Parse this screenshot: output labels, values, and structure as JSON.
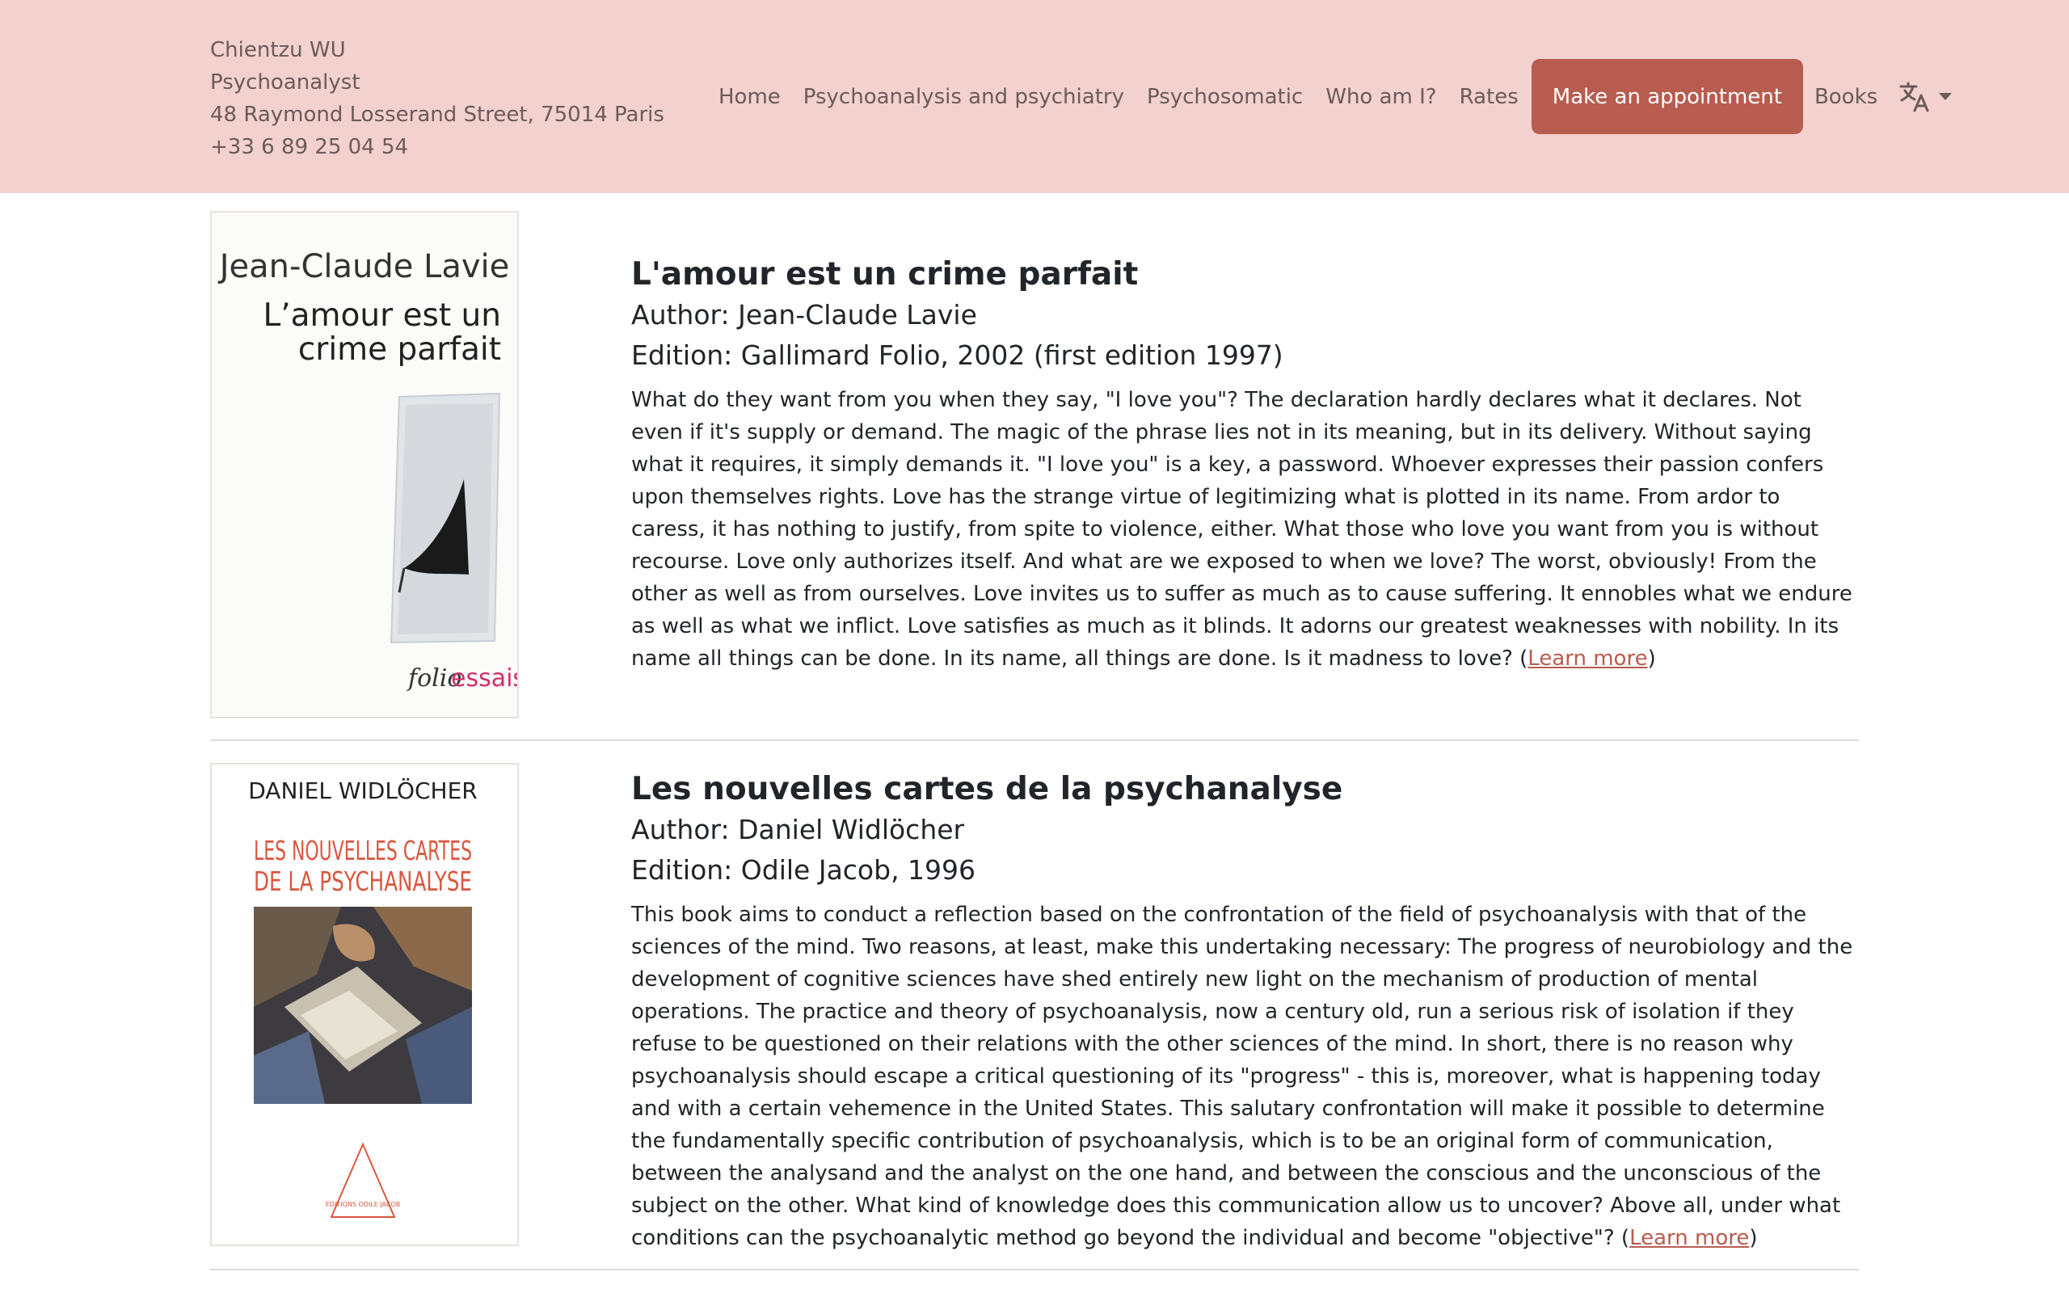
{
  "contact": {
    "name": "Chientzu WU",
    "role": "Psychoanalyst",
    "address": "48 Raymond Losserand Street, 75014 Paris",
    "phone": "+33 6 89 25 04 54"
  },
  "nav": {
    "home": "Home",
    "psychoanalysis": "Psychoanalysis and psychiatry",
    "psychosomatic": "Psychosomatic",
    "who": "Who am I?",
    "rates": "Rates",
    "appointment": "Make an appointment",
    "books": "Books",
    "language_icon": "translate-icon"
  },
  "colors": {
    "header_bg": "#f3d1ce",
    "accent": "#b85c4f",
    "nav_text": "#6b5b5a"
  },
  "books": [
    {
      "title": "L'amour est un crime parfait",
      "author": "Author: Jean-Claude Lavie",
      "edition": "Edition: Gallimard Folio, 2002 (first edition 1997)",
      "description": "What do they want from you when they say, \"I love you\"? The declaration hardly declares what it declares. Not even if it's supply or demand. The magic of the phrase lies not in its meaning, but in its delivery. Without saying what it requires, it simply demands it. \"I love you\" is a key, a password. Whoever expresses their passion confers upon themselves rights. Love has the strange virtue of legitimizing what is plotted in its name. From ardor to caress, it has nothing to justify, from spite to violence, either. What those who love you want from you is without recourse. Love only authorizes itself. And what are we exposed to when we love? The worst, obviously! From the other as well as from ourselves. Love invites us to suffer as much as to cause suffering. It ennobles what we endure as well as what we inflict. Love satisfies as much as it blinds. It adorns our greatest weaknesses with nobility. In its name all things can be done. In its name, all things are done. Is it madness to love? (",
      "learn_more": "Learn more",
      "close_paren": ")",
      "cover": {
        "author": "Jean-Claude Lavie",
        "title_line1": "L’amour est un",
        "title_line2": "crime parfait",
        "publisher_a": "folio",
        "publisher_b": "essais"
      }
    },
    {
      "title": "Les nouvelles cartes de la psychanalyse",
      "author": "Author: Daniel Widlöcher",
      "edition": "Edition: Odile Jacob, 1996",
      "description": "This book aims to conduct a reflection based on the confrontation of the field of psychoanalysis with that of the sciences of the mind. Two reasons, at least, make this undertaking necessary: The progress of neurobiology and the development of cognitive sciences have shed entirely new light on the mechanism of production of mental operations. The practice and theory of psychoanalysis, now a century old, run a serious risk of isolation if they refuse to be questioned on their relations with the other sciences of the mind. In short, there is no reason why psychoanalysis should escape a critical questioning of its \"progress\" - this is, moreover, what is happening today and with a certain vehemence in the United States. This salutary confrontation will make it possible to determine the fundamentally specific contribution of psychoanalysis, which is to be an original form of communication, between the analysand and the analyst on the one hand, and between the conscious and the unconscious of the subject on the other. What kind of knowledge does this communication allow us to uncover? Above all, under what conditions can the psychoanalytic method go beyond the individual and become \"objective\"? (",
      "learn_more": "Learn more",
      "close_paren": ")",
      "cover": {
        "author": "DANIEL WIDLÖCHER",
        "title_line1": "LES NOUVELLES CARTES",
        "title_line2": "DE LA PSYCHANALYSE",
        "publisher": "EDITIONS ODILE JACOB"
      }
    }
  ]
}
